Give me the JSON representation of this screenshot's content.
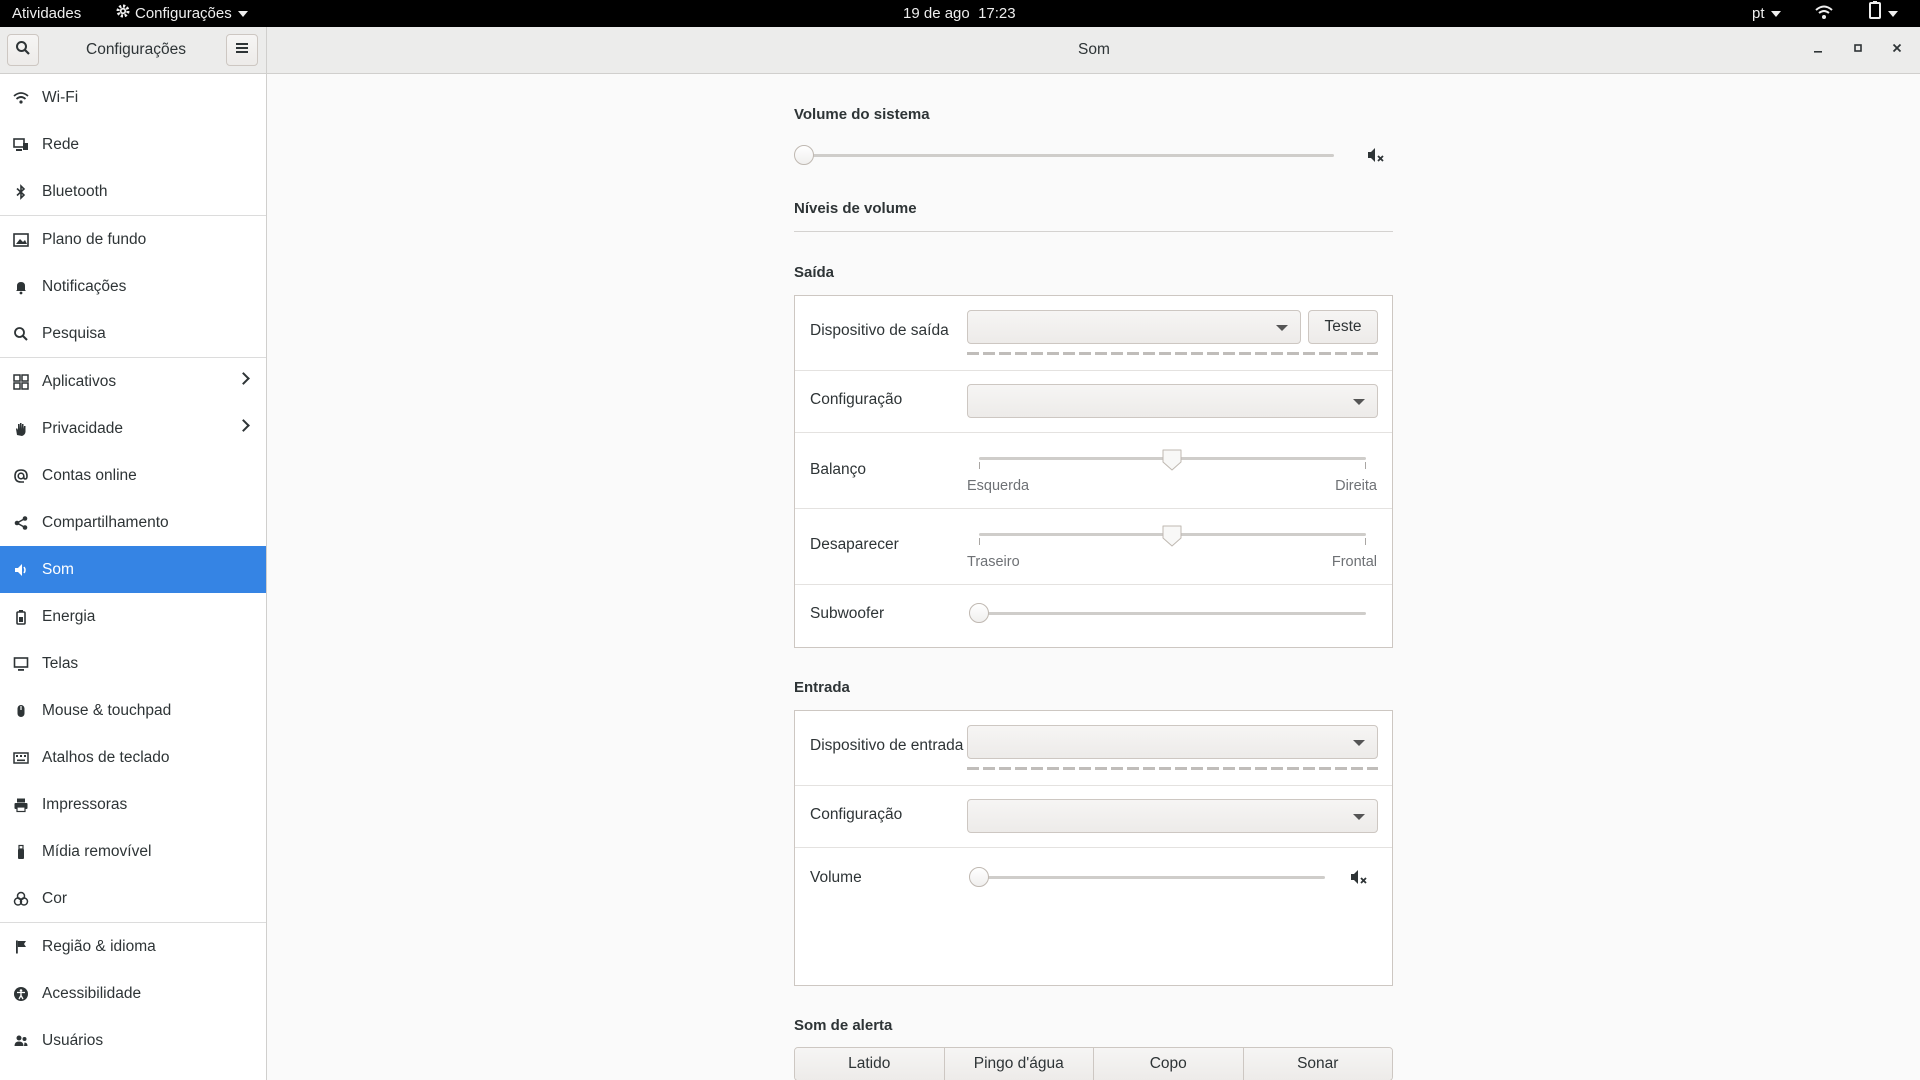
{
  "topbar": {
    "activities": "Atividades",
    "app_menu": "Configurações",
    "clock": "19 de ago  17:23",
    "keyboard_layout": "pt"
  },
  "headerbar": {
    "sidebar_title": "Configurações",
    "panel_title": "Som"
  },
  "sidebar": {
    "items": [
      {
        "label": "Wi-Fi",
        "icon": "wifi-icon"
      },
      {
        "label": "Rede",
        "icon": "network-icon"
      },
      {
        "label": "Bluetooth",
        "icon": "bluetooth-icon"
      },
      {
        "label": "Plano de fundo",
        "icon": "background-icon"
      },
      {
        "label": "Notificações",
        "icon": "bell-icon"
      },
      {
        "label": "Pesquisa",
        "icon": "search-icon"
      },
      {
        "label": "Aplicativos",
        "icon": "apps-grid-icon"
      },
      {
        "label": "Privacidade",
        "icon": "hand-icon"
      },
      {
        "label": "Contas online",
        "icon": "at-sign-icon"
      },
      {
        "label": "Compartilhamento",
        "icon": "share-icon"
      },
      {
        "label": "Som",
        "icon": "speaker-icon"
      },
      {
        "label": "Energia",
        "icon": "battery-icon"
      },
      {
        "label": "Telas",
        "icon": "display-icon"
      },
      {
        "label": "Mouse & touchpad",
        "icon": "mouse-icon"
      },
      {
        "label": "Atalhos de teclado",
        "icon": "keyboard-icon"
      },
      {
        "label": "Impressoras",
        "icon": "printer-icon"
      },
      {
        "label": "Mídia removível",
        "icon": "usb-drive-icon"
      },
      {
        "label": "Cor",
        "icon": "color-icon"
      },
      {
        "label": "Região & idioma",
        "icon": "flag-icon"
      },
      {
        "label": "Acessibilidade",
        "icon": "accessibility-icon"
      },
      {
        "label": "Usuários",
        "icon": "users-icon"
      }
    ]
  },
  "sound": {
    "system_volume_title": "Volume do sistema",
    "system_volume_level": 0,
    "volume_levels_title": "Níveis de volume",
    "output": {
      "title": "Saída",
      "device_label": "Dispositivo de saída",
      "device_value": "",
      "test_button": "Teste",
      "config_label": "Configuração",
      "config_value": "",
      "balance_label": "Balanço",
      "balance_left": "Esquerda",
      "balance_right": "Direita",
      "balance_level": 0.5,
      "fade_label": "Desaparecer",
      "fade_rear": "Traseiro",
      "fade_front": "Frontal",
      "fade_level": 0.5,
      "subwoofer_label": "Subwoofer",
      "subwoofer_level": 0
    },
    "input": {
      "title": "Entrada",
      "device_label": "Dispositivo de entrada",
      "device_value": "",
      "config_label": "Configuração",
      "config_value": "",
      "volume_label": "Volume",
      "volume_level": 0
    },
    "alert": {
      "title": "Som de alerta",
      "options": [
        "Latido",
        "Pingo d'água",
        "Copo",
        "Sonar"
      ]
    }
  }
}
